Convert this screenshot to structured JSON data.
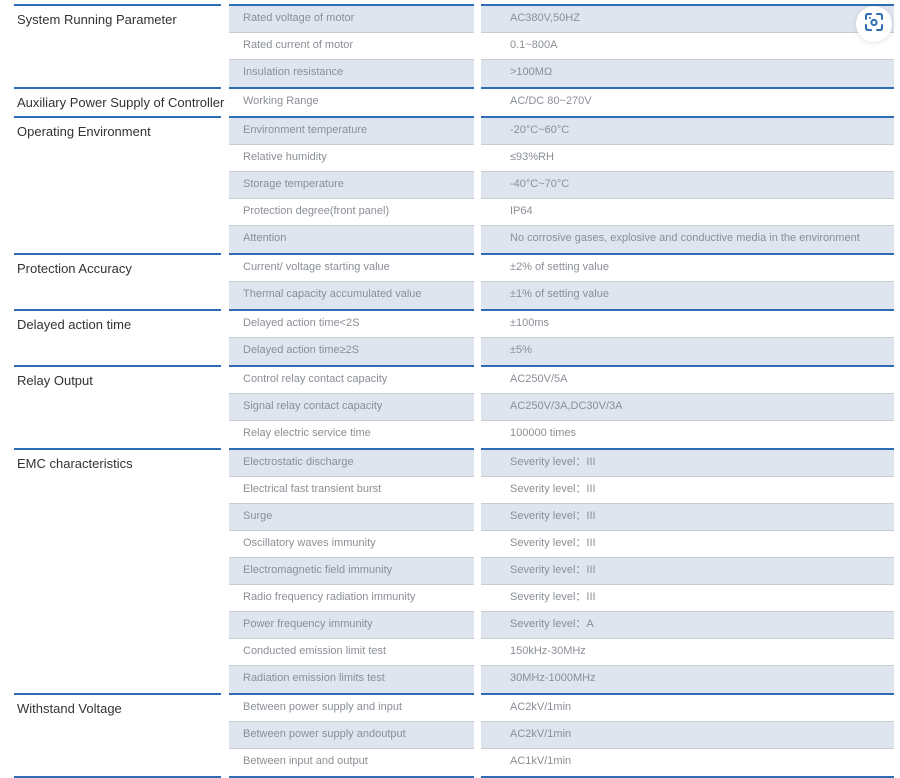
{
  "sections": [
    {
      "label": "System Running Parameter",
      "rows": [
        {
          "param": "Rated voltage of motor",
          "value": "AC380V,50HZ"
        },
        {
          "param": "Rated current of motor",
          "value": "0.1~800A"
        },
        {
          "param": "Insulation resistance",
          "value": ">100MΩ"
        }
      ]
    },
    {
      "label": "Auxiliary Power Supply of Controller",
      "rows": [
        {
          "param": "Working Range",
          "value": "AC/DC 80~270V"
        }
      ]
    },
    {
      "label": "Operating Environment",
      "rows": [
        {
          "param": "Environment temperature",
          "value": "-20°C~60°C"
        },
        {
          "param": "Relative humidity",
          "value": "≤93%RH"
        },
        {
          "param": "Storage temperature",
          "value": "-40°C~70°C"
        },
        {
          "param": "Protection degree(front panel)",
          "value": "IP64"
        },
        {
          "param": "Attention",
          "value": "No corrosive gases, explosive and conductive media in the environment"
        }
      ]
    },
    {
      "label": "Protection Accuracy",
      "rows": [
        {
          "param": "Current/ voltage starting value",
          "value": "±2% of setting value"
        },
        {
          "param": "Thermal capacity accumulated value",
          "value": "±1% of setting value"
        }
      ]
    },
    {
      "label": "Delayed action time",
      "rows": [
        {
          "param": "Delayed action time<2S",
          "value": "±100ms"
        },
        {
          "param": "Delayed action time≥2S",
          "value": "±5%"
        }
      ]
    },
    {
      "label": "Relay Output",
      "rows": [
        {
          "param": "Control relay contact capacity",
          "value": "AC250V/5A"
        },
        {
          "param": "Signal relay contact capacity",
          "value": "AC250V/3A,DC30V/3A"
        },
        {
          "param": "Relay electric service time",
          "value": "100000 times"
        }
      ]
    },
    {
      "label": "EMC characteristics",
      "rows": [
        {
          "param": "Electrostatic discharge",
          "value": "Severity level：III"
        },
        {
          "param": "Electrical fast transient burst",
          "value": "Severity level：III"
        },
        {
          "param": "Surge",
          "value": "Severity level：III"
        },
        {
          "param": "Oscillatory waves immunity",
          "value": "Severity level：III"
        },
        {
          "param": "Electromagnetic field immunity",
          "value": "Severity level：III"
        },
        {
          "param": "Radio frequency radiation immunity",
          "value": "Severity level：III"
        },
        {
          "param": "Power frequency immunity",
          "value": "Severity level：A"
        },
        {
          "param": "Conducted emission limit test",
          "value": "150kHz-30MHz"
        },
        {
          "param": "Radiation emission limits test",
          "value": "30MHz-1000MHz"
        }
      ]
    },
    {
      "label": "Withstand Voltage",
      "rows": [
        {
          "param": "Between power supply and input",
          "value": "AC2kV/1min"
        },
        {
          "param": "Between power supply andoutput",
          "value": "AC2kV/1min"
        },
        {
          "param": "Between input and output",
          "value": "AC1kV/1min"
        }
      ]
    }
  ],
  "overlay": {
    "scan_icon": "scan-lens-icon"
  },
  "colors": {
    "accent_line": "#2e6db4",
    "shaded_row": "#dfe5ef",
    "row_divider": "#c9ccd1",
    "label_text": "#333333",
    "cell_text": "#8a8f96",
    "icon": "#2e6db4"
  }
}
